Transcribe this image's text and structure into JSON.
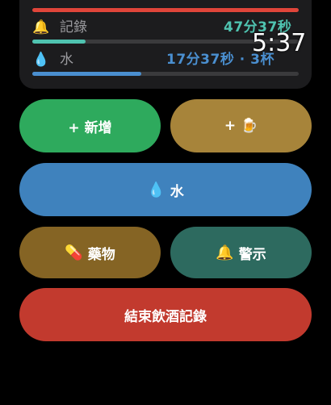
{
  "status_bar": {
    "time": "5:37"
  },
  "summary": {
    "top_partial": {
      "color": "#e0453a"
    },
    "rows": [
      {
        "icon": "🔔",
        "label": "記錄",
        "value": "47分37秒",
        "value_color": "#4fc3b0",
        "bar_fill": 0.2,
        "bar_color": "#4fc3b0"
      },
      {
        "icon": "💧",
        "label": "水",
        "value": "17分37秒 · 3杯",
        "value_color": "#4a8fd0",
        "bar_fill": 0.41,
        "bar_color": "#4a8fd0"
      }
    ]
  },
  "buttons": {
    "add": {
      "label": "+ 新增",
      "color": "#2eaa5d"
    },
    "beer": {
      "label": "+ 🍺",
      "color": "#a7843a"
    },
    "water": {
      "icon": "💧",
      "label": "水",
      "color": "#3f82bd"
    },
    "medicine": {
      "icon": "💊",
      "label": "藥物",
      "color": "#856424"
    },
    "alert": {
      "icon": "🔔",
      "label": "警示",
      "color": "#2d6a5f"
    },
    "end": {
      "label": "結束飲酒記錄",
      "color": "#c23a2e"
    }
  }
}
